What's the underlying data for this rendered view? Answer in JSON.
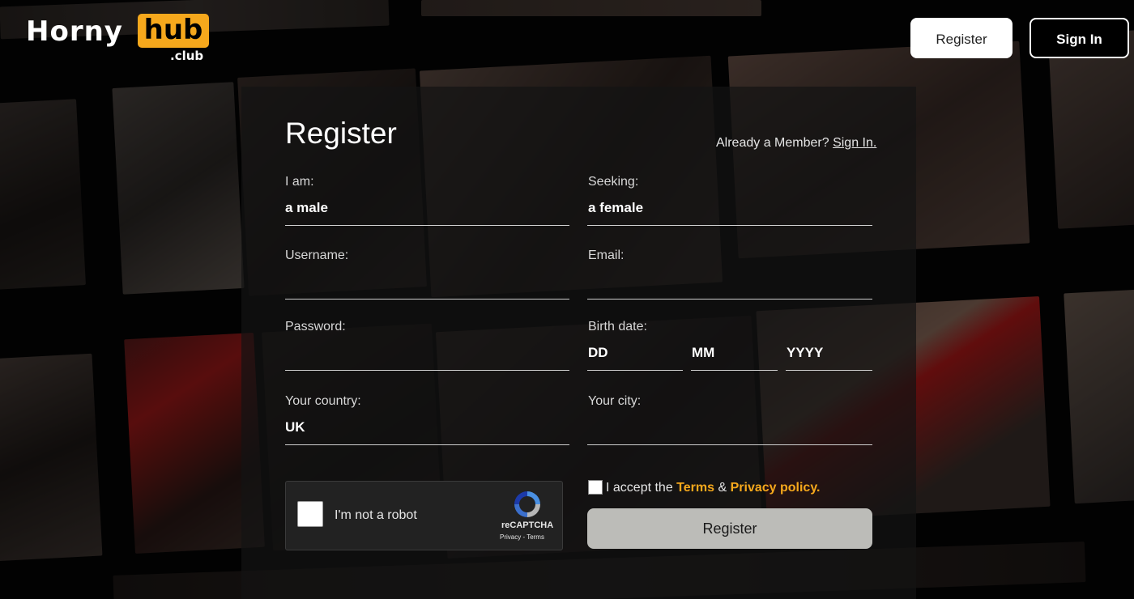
{
  "logo": {
    "word1": "Horny",
    "word2": "hub",
    "suffix": ".club"
  },
  "header": {
    "register_label": "Register",
    "signin_label": "Sign In"
  },
  "form": {
    "title": "Register",
    "member_prompt": "Already a Member?",
    "member_link": "Sign In.",
    "iam": {
      "label": "I am:",
      "value": "a male"
    },
    "seeking": {
      "label": "Seeking:",
      "value": "a female"
    },
    "username": {
      "label": "Username:",
      "value": ""
    },
    "email": {
      "label": "Email:",
      "value": ""
    },
    "password": {
      "label": "Password:",
      "value": ""
    },
    "birthdate": {
      "label": "Birth date:",
      "day": "DD",
      "month": "MM",
      "year": "YYYY"
    },
    "country": {
      "label": "Your country:",
      "value": "UK"
    },
    "city": {
      "label": "Your city:",
      "value": ""
    },
    "captcha": {
      "text": "I'm not a robot",
      "brand": "reCAPTCHA",
      "links": "Privacy - Terms"
    },
    "accept": {
      "prefix": "I accept the",
      "terms": "Terms",
      "amp": "&",
      "privacy": "Privacy policy."
    },
    "submit_label": "Register"
  },
  "colors": {
    "accent": "#f6a81c",
    "submit_bg": "#bcbcb8"
  }
}
